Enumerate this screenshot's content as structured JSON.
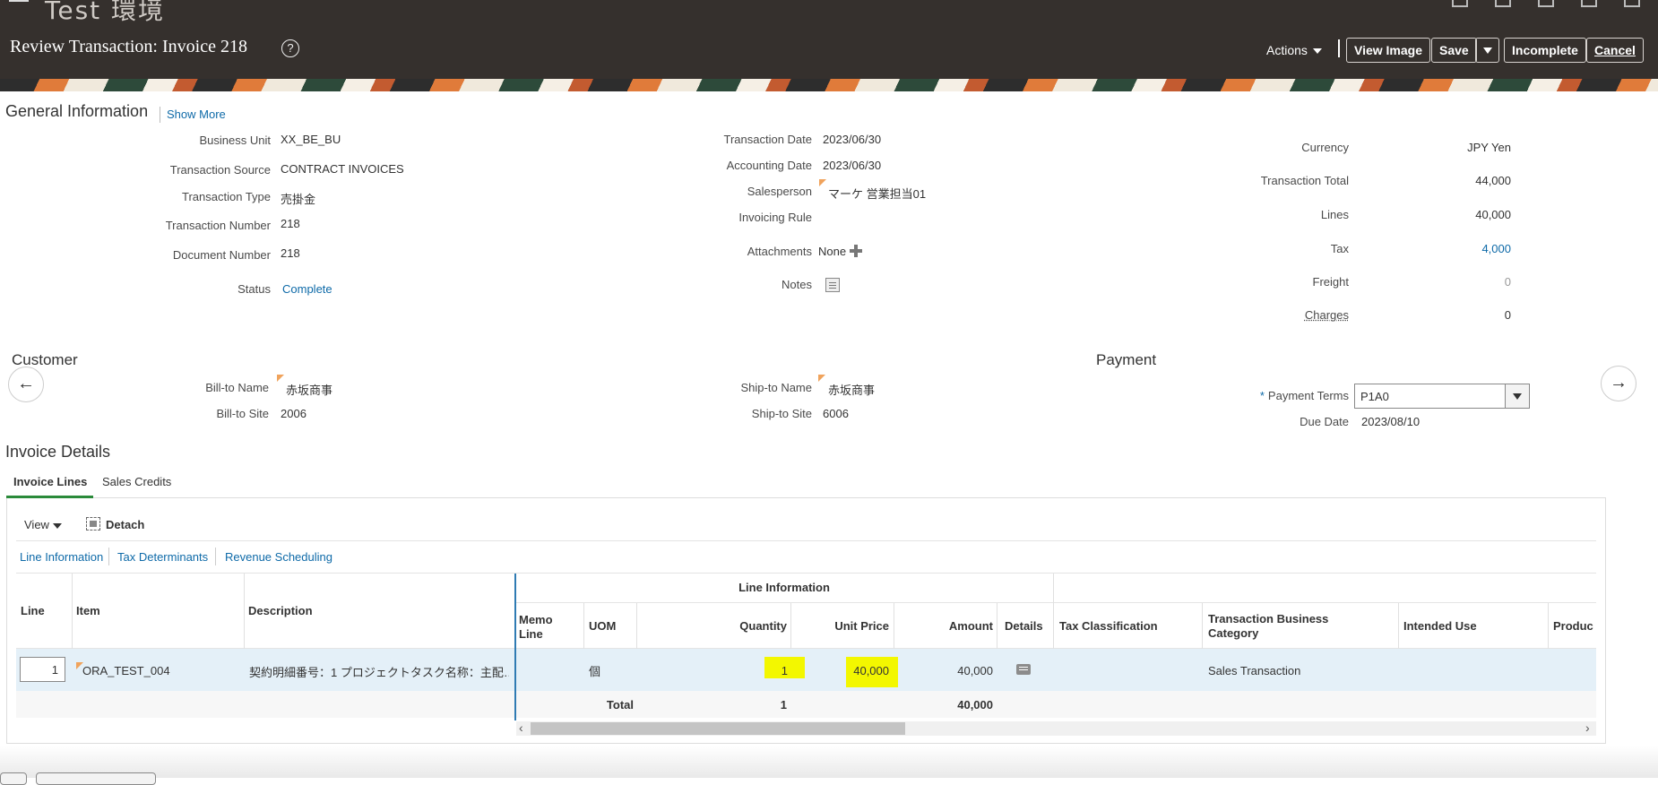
{
  "header": {
    "env_title": "Test 環境",
    "page_title": "Review Transaction: Invoice 218",
    "help_glyph": "?",
    "actions_label": "Actions",
    "view_image": "View Image",
    "save": "Save",
    "incomplete": "Incomplete",
    "cancel": "Cancel"
  },
  "general": {
    "title": "General Information",
    "show_more": "Show More",
    "business_unit_label": "Business Unit",
    "business_unit": "XX_BE_BU",
    "transaction_source_label": "Transaction Source",
    "transaction_source": "CONTRACT INVOICES",
    "transaction_type_label": "Transaction Type",
    "transaction_type": "売掛金",
    "transaction_number_label": "Transaction Number",
    "transaction_number": "218",
    "document_number_label": "Document Number",
    "document_number": "218",
    "status_label": "Status",
    "status": "Complete",
    "transaction_date_label": "Transaction Date",
    "transaction_date": "2023/06/30",
    "accounting_date_label": "Accounting Date",
    "accounting_date": "2023/06/30",
    "salesperson_label": "Salesperson",
    "salesperson": "マーケ 営業担当01",
    "invoicing_rule_label": "Invoicing Rule",
    "attachments_label": "Attachments",
    "attachments": "None",
    "notes_label": "Notes",
    "currency_label": "Currency",
    "currency": "JPY Yen",
    "transaction_total_label": "Transaction Total",
    "transaction_total": "44,000",
    "lines_label": "Lines",
    "lines": "40,000",
    "tax_label": "Tax",
    "tax": "4,000",
    "freight_label": "Freight",
    "freight": "0",
    "charges_label": "Charges",
    "charges": "0"
  },
  "customer": {
    "title": "Customer",
    "bill_to_name_label": "Bill-to Name",
    "bill_to_name": "赤坂商事",
    "bill_to_site_label": "Bill-to Site",
    "bill_to_site": "2006",
    "ship_to_name_label": "Ship-to Name",
    "ship_to_name": "赤坂商事",
    "ship_to_site_label": "Ship-to Site",
    "ship_to_site": "6006",
    "prev_glyph": "←",
    "next_glyph": "→"
  },
  "payment": {
    "title": "Payment",
    "required_mark": "*",
    "payment_terms_label": "Payment Terms",
    "payment_terms": "P1A0",
    "due_date_label": "Due Date",
    "due_date": "2023/08/10"
  },
  "invoice_details": {
    "title": "Invoice Details",
    "tabs": [
      "Invoice Lines",
      "Sales Credits"
    ],
    "view_label": "View",
    "detach_label": "Detach",
    "sublinks": [
      "Line Information",
      "Tax Determinants",
      "Revenue Scheduling"
    ]
  },
  "table": {
    "group_header": "Line Information",
    "columns": {
      "line": "Line",
      "item": "Item",
      "description": "Description",
      "memo_line": "Memo Line",
      "uom": "UOM",
      "quantity": "Quantity",
      "unit_price": "Unit Price",
      "amount": "Amount",
      "details": "Details",
      "tax_classification": "Tax Classification",
      "transaction_business_category": "Transaction Business Category",
      "intended_use": "Intended Use",
      "product": "Produc"
    },
    "row": {
      "line": "1",
      "item": "ORA_TEST_004",
      "description": "契約明細番号：1 プロジェクトタスク名称：主配…",
      "uom": "個",
      "quantity": "1",
      "unit_price": "40,000",
      "amount": "40,000",
      "transaction_business_category": "Sales Transaction"
    },
    "total": {
      "label": "Total",
      "quantity": "1",
      "amount": "40,000"
    },
    "scroll_left": "‹",
    "scroll_right": "›"
  },
  "colors": {
    "header_bg": "#35302d",
    "link": "#0e6aa8",
    "highlight": "#f3f700",
    "selected_row": "#e4f0f8",
    "active_tab": "#2a8a3a"
  }
}
